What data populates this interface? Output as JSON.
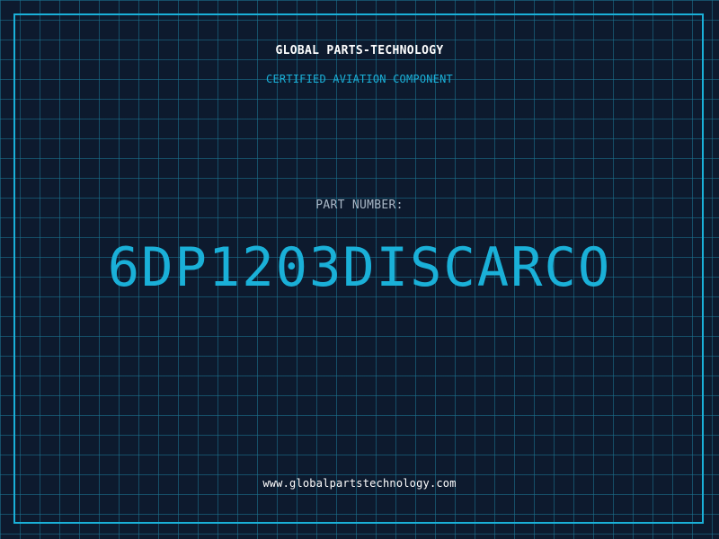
{
  "header": {
    "company": "GLOBAL PARTS-TECHNOLOGY",
    "subtitle": "CERTIFIED AVIATION COMPONENT"
  },
  "part": {
    "label": "PART NUMBER:",
    "number": "6DP1203DISCARCO"
  },
  "footer": {
    "website": "www.globalpartstechnology.com"
  },
  "colors": {
    "background": "#0d1a2e",
    "accent": "#1ab0d8",
    "grid": "#1c7896",
    "label": "#a9b7c6",
    "white": "#ffffff"
  }
}
